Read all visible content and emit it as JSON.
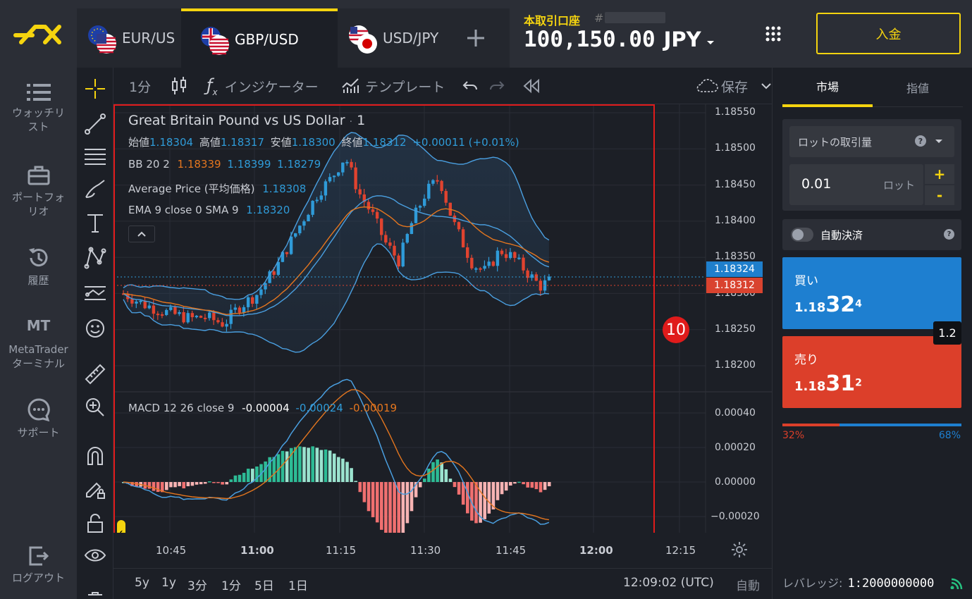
{
  "tabs": [
    {
      "label": "EUR/US"
    },
    {
      "label": "GBP/USD"
    },
    {
      "label": "USD/JPY"
    }
  ],
  "account": {
    "type": "本取引口座",
    "hash": "#",
    "balance": "100,150.00",
    "currency": "JPY"
  },
  "deposit_label": "入金",
  "nav": {
    "watchlist": "ウォッチリスト",
    "portfolio": "ポートフォリオ",
    "history": "履歴",
    "mt_icon": "MT",
    "metatrader": "MetaTraderターミナル",
    "support": "サポート",
    "logout": "ログアウト"
  },
  "toolbar": {
    "interval": "1分",
    "indicators": "インジケーター",
    "templates": "テンプレート",
    "save": "保存"
  },
  "chart": {
    "title": "Great Britain Pound vs US Dollar",
    "title_sep": "·",
    "title_interval": "1",
    "ohlc": {
      "open_label": "始値",
      "open": "1.18304",
      "high_label": "高値",
      "high": "1.18317",
      "low_label": "安値",
      "low": "1.18300",
      "close_label": "終値",
      "close": "1.18312",
      "change": "+0.00011 (+0.01%)"
    },
    "bb": {
      "label": "BB 20 2",
      "v1": "1.18339",
      "v2": "1.18399",
      "v3": "1.18279"
    },
    "avg": {
      "label": "Average Price (平均価格)",
      "v": "1.18308"
    },
    "ema": {
      "label": "EMA 9 close 0 SMA 9",
      "v": "1.18320"
    },
    "macd": {
      "label": "MACD 12 26 close 9",
      "v1": "-0.00004",
      "v2": "-0.00024",
      "v3": "-0.00019"
    },
    "price_ticks": [
      "1.18550",
      "1.18500",
      "1.18450",
      "1.18400",
      "1.18350",
      "1.18300",
      "1.18250",
      "1.18200"
    ],
    "macd_ticks": [
      "0.00040",
      "0.00020",
      "0.00000",
      "−0.00020"
    ],
    "time_ticks": [
      "10:45",
      "11:00",
      "11:15",
      "11:30",
      "11:45",
      "12:00",
      "12:15"
    ],
    "ask_tag": "1.18324",
    "bid_tag": "1.18312",
    "badge": "10",
    "colors": {
      "up": "#2f9bd8",
      "down": "#e0432f",
      "band": "#4a9fe0",
      "ema": "#e4761f",
      "hist_up": "#2dbb95",
      "hist_down": "#f07070"
    }
  },
  "periods": [
    "5y",
    "1y",
    "3分",
    "1分",
    "5日",
    "1日"
  ],
  "clock": "12:09:02 (UTC)",
  "auto": "自動",
  "leverage_label": "レバレッジ:",
  "leverage_value": "1:2000000000",
  "order": {
    "tab_market": "市場",
    "tab_limit": "指値",
    "lot_label": "ロットの取引量",
    "lot_value": "0.01",
    "lot_unit": "ロット",
    "plus": "+",
    "minus": "-",
    "autoclose": "自動決済",
    "buy_label": "買い",
    "buy_big": "1.18",
    "buy_mid": "32",
    "buy_small": "4",
    "sell_label": "売り",
    "sell_big": "1.18",
    "sell_mid": "31",
    "sell_small": "2",
    "spread": "1.2",
    "sell_pct": "32%",
    "buy_pct": "68%"
  }
}
